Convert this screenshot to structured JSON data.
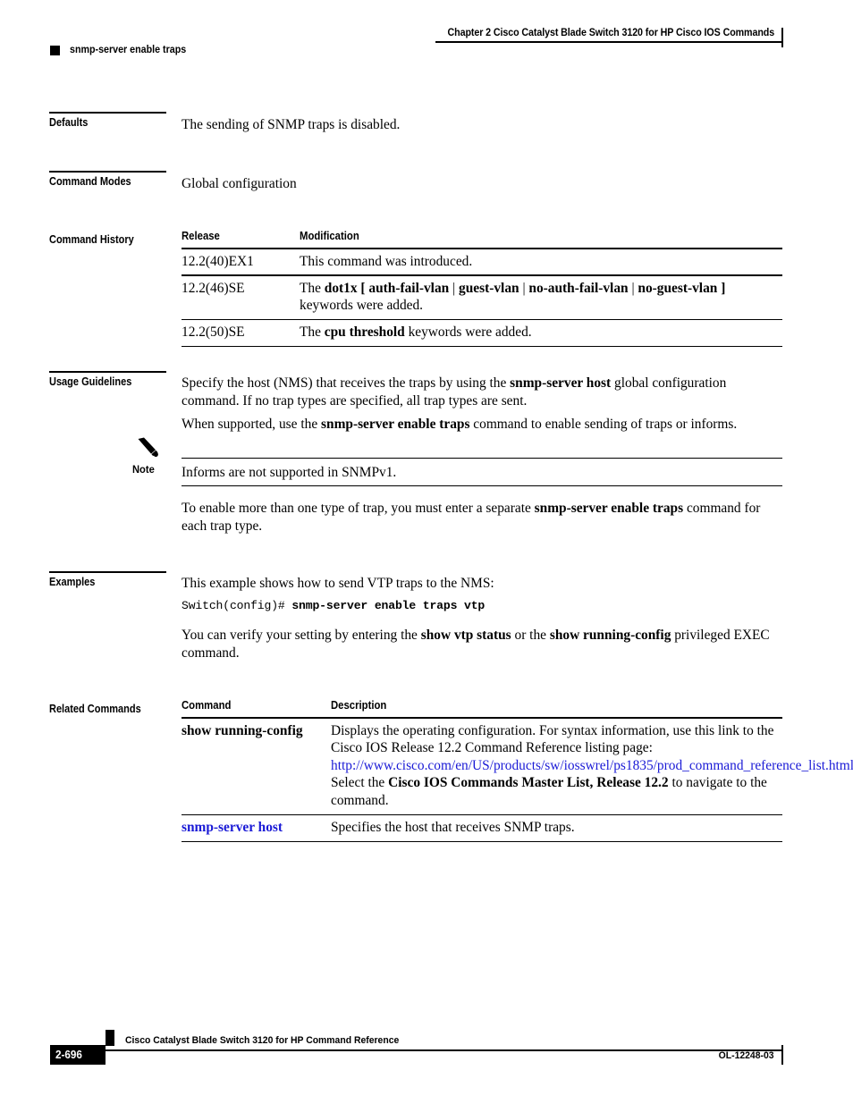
{
  "header": {
    "chapter": "Chapter  2 Cisco Catalyst Blade Switch 3120 for HP Cisco IOS Commands",
    "command_name": "snmp-server enable traps"
  },
  "sections": {
    "defaults": {
      "label": "Defaults",
      "text": "The sending of SNMP traps is disabled."
    },
    "command_modes": {
      "label": "Command Modes",
      "text": "Global configuration"
    },
    "command_history": {
      "label": "Command History",
      "columns": [
        "Release",
        "Modification"
      ],
      "rows": [
        {
          "release": "12.2(40)EX1",
          "modification_plain": "This command was introduced."
        },
        {
          "release": "12.2(46)SE",
          "modification_lead": "The ",
          "kw1": "dot1x",
          "bracket_open": "[",
          "kw2": "auth-fail-vlan",
          "sep1": "|",
          "kw3": "guest-vlan",
          "sep2": "|",
          "kw4": "no-auth-fail-vlan",
          "sep3": "|",
          "kw5": "no-guest-vlan",
          "bracket_close": "]",
          "modification_tail": "keywords were added."
        },
        {
          "release": "12.2(50)SE",
          "modification_lead": "The ",
          "kw1": "cpu threshold",
          "modification_tail": " keywords were added."
        }
      ]
    },
    "usage_guidelines": {
      "label": "Usage Guidelines",
      "para1_a": "Specify the host (NMS) that receives the traps by using the ",
      "para1_b": "snmp-server host",
      "para1_c": " global configuration command. If no trap types are specified, all trap types are sent.",
      "para2_a": "When supported, use the ",
      "para2_b": "snmp-server enable traps",
      "para2_c": " command to enable sending of traps or informs.",
      "note_label": "Note",
      "note_text": "Informs are not supported in SNMPv1.",
      "para3_a": "To enable more than one type of trap, you must enter a separate ",
      "para3_b": "snmp-server enable traps",
      "para3_c": " command for each trap type."
    },
    "examples": {
      "label": "Examples",
      "intro": "This example shows how to send VTP traps to the NMS:",
      "code_prompt": "Switch(config)# ",
      "code_command": "snmp-server enable traps vtp",
      "verify_a": "You can verify your setting by entering the ",
      "verify_b": "show vtp status",
      "verify_c": " or the ",
      "verify_d": "show running-config",
      "verify_e": " privileged EXEC command."
    },
    "related_commands": {
      "label": "Related Commands",
      "columns": [
        "Command",
        "Description"
      ],
      "rows": [
        {
          "command": "show running-config",
          "command_style": "bold",
          "desc_line1": "Displays the operating configuration. For syntax information, use this link to the Cisco IOS Release 12.2 Command Reference listing page:",
          "link_line1": "http://www.cisco.com/en/US/products/sw/iosswrel/ps1835/prod_command",
          "link_line2": "_reference_list.html",
          "desc_line2_a": "Select the ",
          "desc_line2_b": "Cisco IOS Commands Master List, Release 12.2",
          "desc_line2_c": " to navigate to the command."
        },
        {
          "command": "snmp-server host",
          "command_style": "link",
          "desc_line1": "Specifies the host that receives SNMP traps."
        }
      ]
    }
  },
  "footer": {
    "title": "Cisco Catalyst Blade Switch 3120 for HP Command Reference",
    "page_number": "2-696",
    "doc_id": "OL-12248-03"
  },
  "colors": {
    "link": "#1a1ad6",
    "text": "#000000",
    "background": "#ffffff"
  }
}
